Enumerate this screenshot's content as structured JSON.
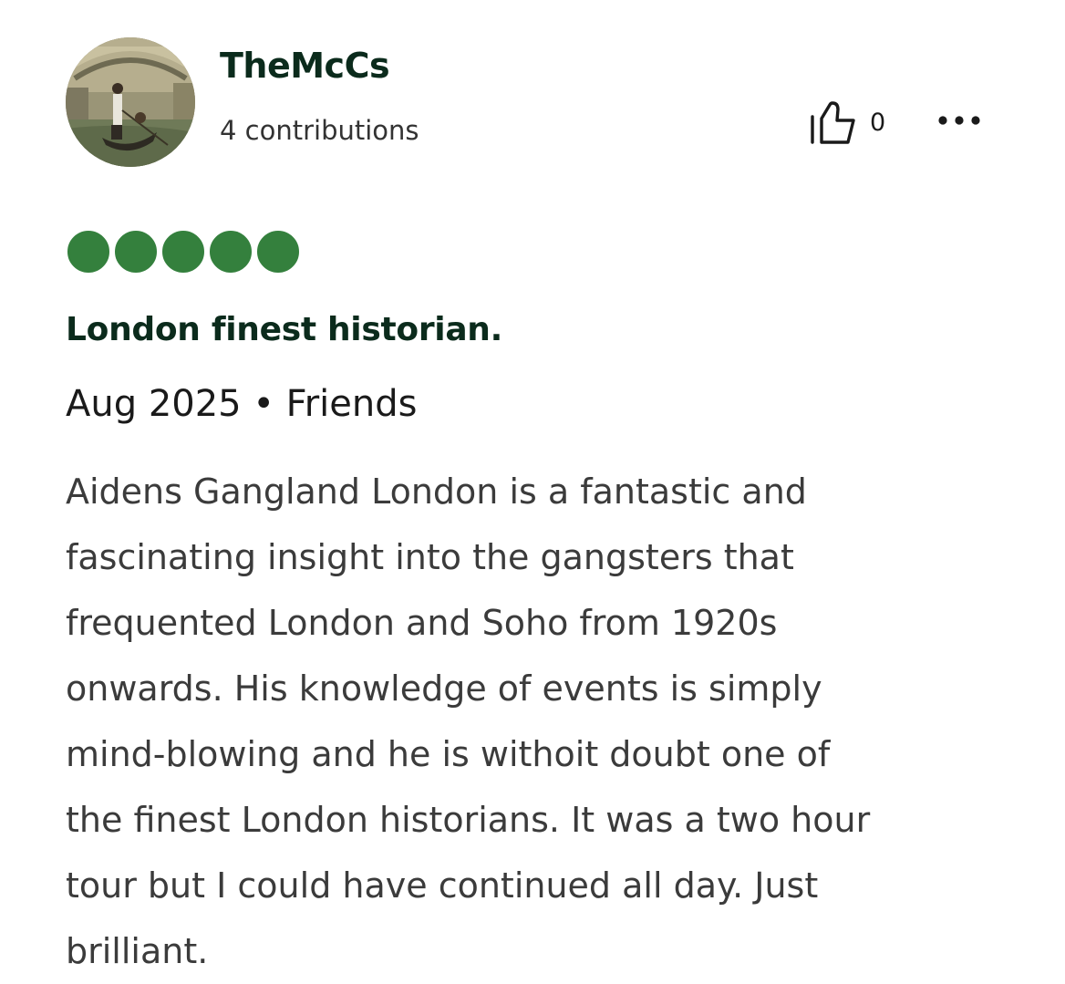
{
  "review": {
    "author": {
      "username": "TheMcCs",
      "contributions": "4 contributions",
      "avatar_icon": "gondola-photo"
    },
    "helpful": {
      "icon": "thumbs-up-icon",
      "count": "0"
    },
    "more_icon": "more-options-icon",
    "rating": {
      "value": 5,
      "max": 5,
      "color": "#34803d"
    },
    "title": "London finest historian.",
    "meta": "Aug 2025 • Friends",
    "body_lines": [
      "Aidens Gangland London is a fantastic and",
      "fascinating insight into the gangsters that",
      "frequented London and Soho from 1920s",
      "onwards. His knowledge of events is simply",
      "mind-blowing and he is withoit doubt one of",
      "the finest London historians. It was a two hour",
      "tour but I could have continued all day. Just",
      "brilliant."
    ]
  }
}
